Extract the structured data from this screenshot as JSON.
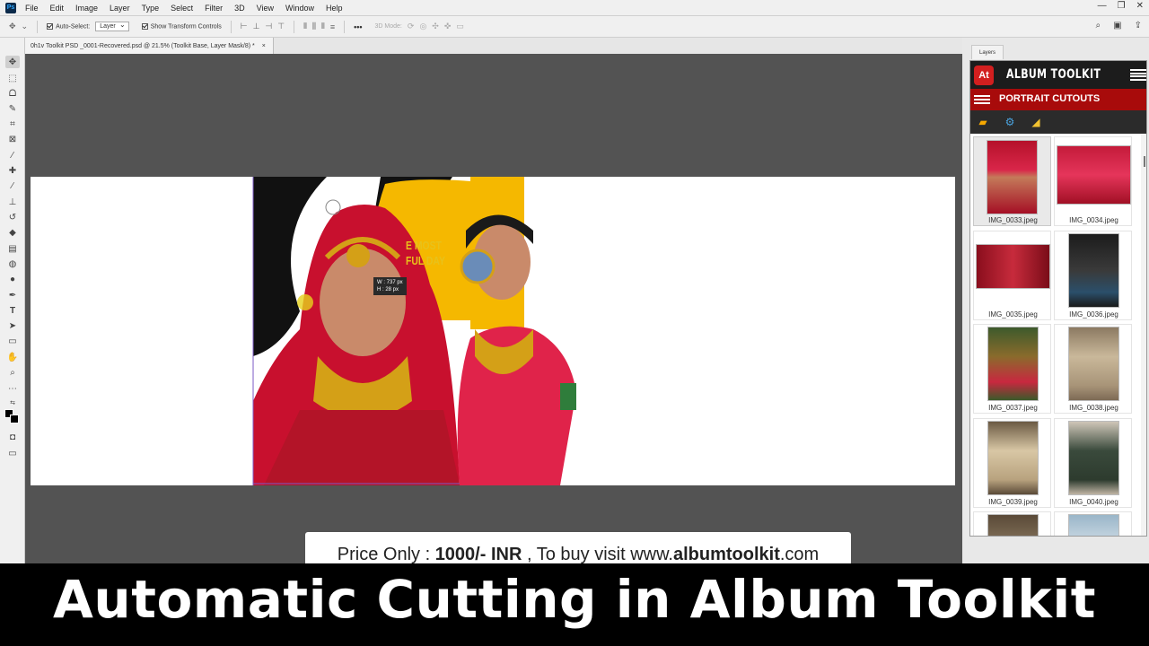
{
  "menubar": {
    "app_icon": "photoshop-ps-icon",
    "app_badge": "Ps",
    "items": [
      "File",
      "Edit",
      "Image",
      "Layer",
      "Type",
      "Select",
      "Filter",
      "3D",
      "View",
      "Window",
      "Help"
    ],
    "window_controls": [
      "—",
      "❐",
      "✕"
    ]
  },
  "options_bar": {
    "auto_select_label": "Auto-Select:",
    "auto_select_value": "Layer",
    "show_transform_label": "Show Transform Controls",
    "mode_3d_label": "3D Mode:",
    "more_label": "•••"
  },
  "document_tab": {
    "title": "0h1v Toolkit PSD _0001-Recovered.psd @ 21.5% (Toolkit Base, Layer Mask/8) *",
    "close": "×"
  },
  "canvas": {
    "measure_w": "W : 737 px",
    "measure_h": "H : 28 px",
    "poster_text_1": "E MOST",
    "poster_text_2": "FUL DAY"
  },
  "panel": {
    "tab_label": "Layers",
    "logo_text": "At",
    "title": "ALBUM TOOLKIT",
    "section": "PORTRAIT CUTOUTS",
    "thumbnails": [
      {
        "label": "IMG_0033.jpeg",
        "selected": true
      },
      {
        "label": "IMG_0034.jpeg",
        "selected": false
      },
      {
        "label": "IMG_0035.jpeg",
        "selected": false
      },
      {
        "label": "IMG_0036.jpeg",
        "selected": false
      },
      {
        "label": "IMG_0037.jpeg",
        "selected": false
      },
      {
        "label": "IMG_0038.jpeg",
        "selected": false
      },
      {
        "label": "IMG_0039.jpeg",
        "selected": false
      },
      {
        "label": "IMG_0040.jpeg",
        "selected": false
      }
    ]
  },
  "banner": {
    "prefix": "Price Only : ",
    "price": "1000/- INR",
    "middle": " , To buy visit www.",
    "site": "albumtoolkit",
    "suffix": ".com"
  },
  "title_band": {
    "text": "Automatic Cutting in Album Toolkit"
  },
  "colors": {
    "brand_red": "#a80b0b",
    "accent_yellow": "#f5b800",
    "panel_dark": "#1c1c1c"
  }
}
